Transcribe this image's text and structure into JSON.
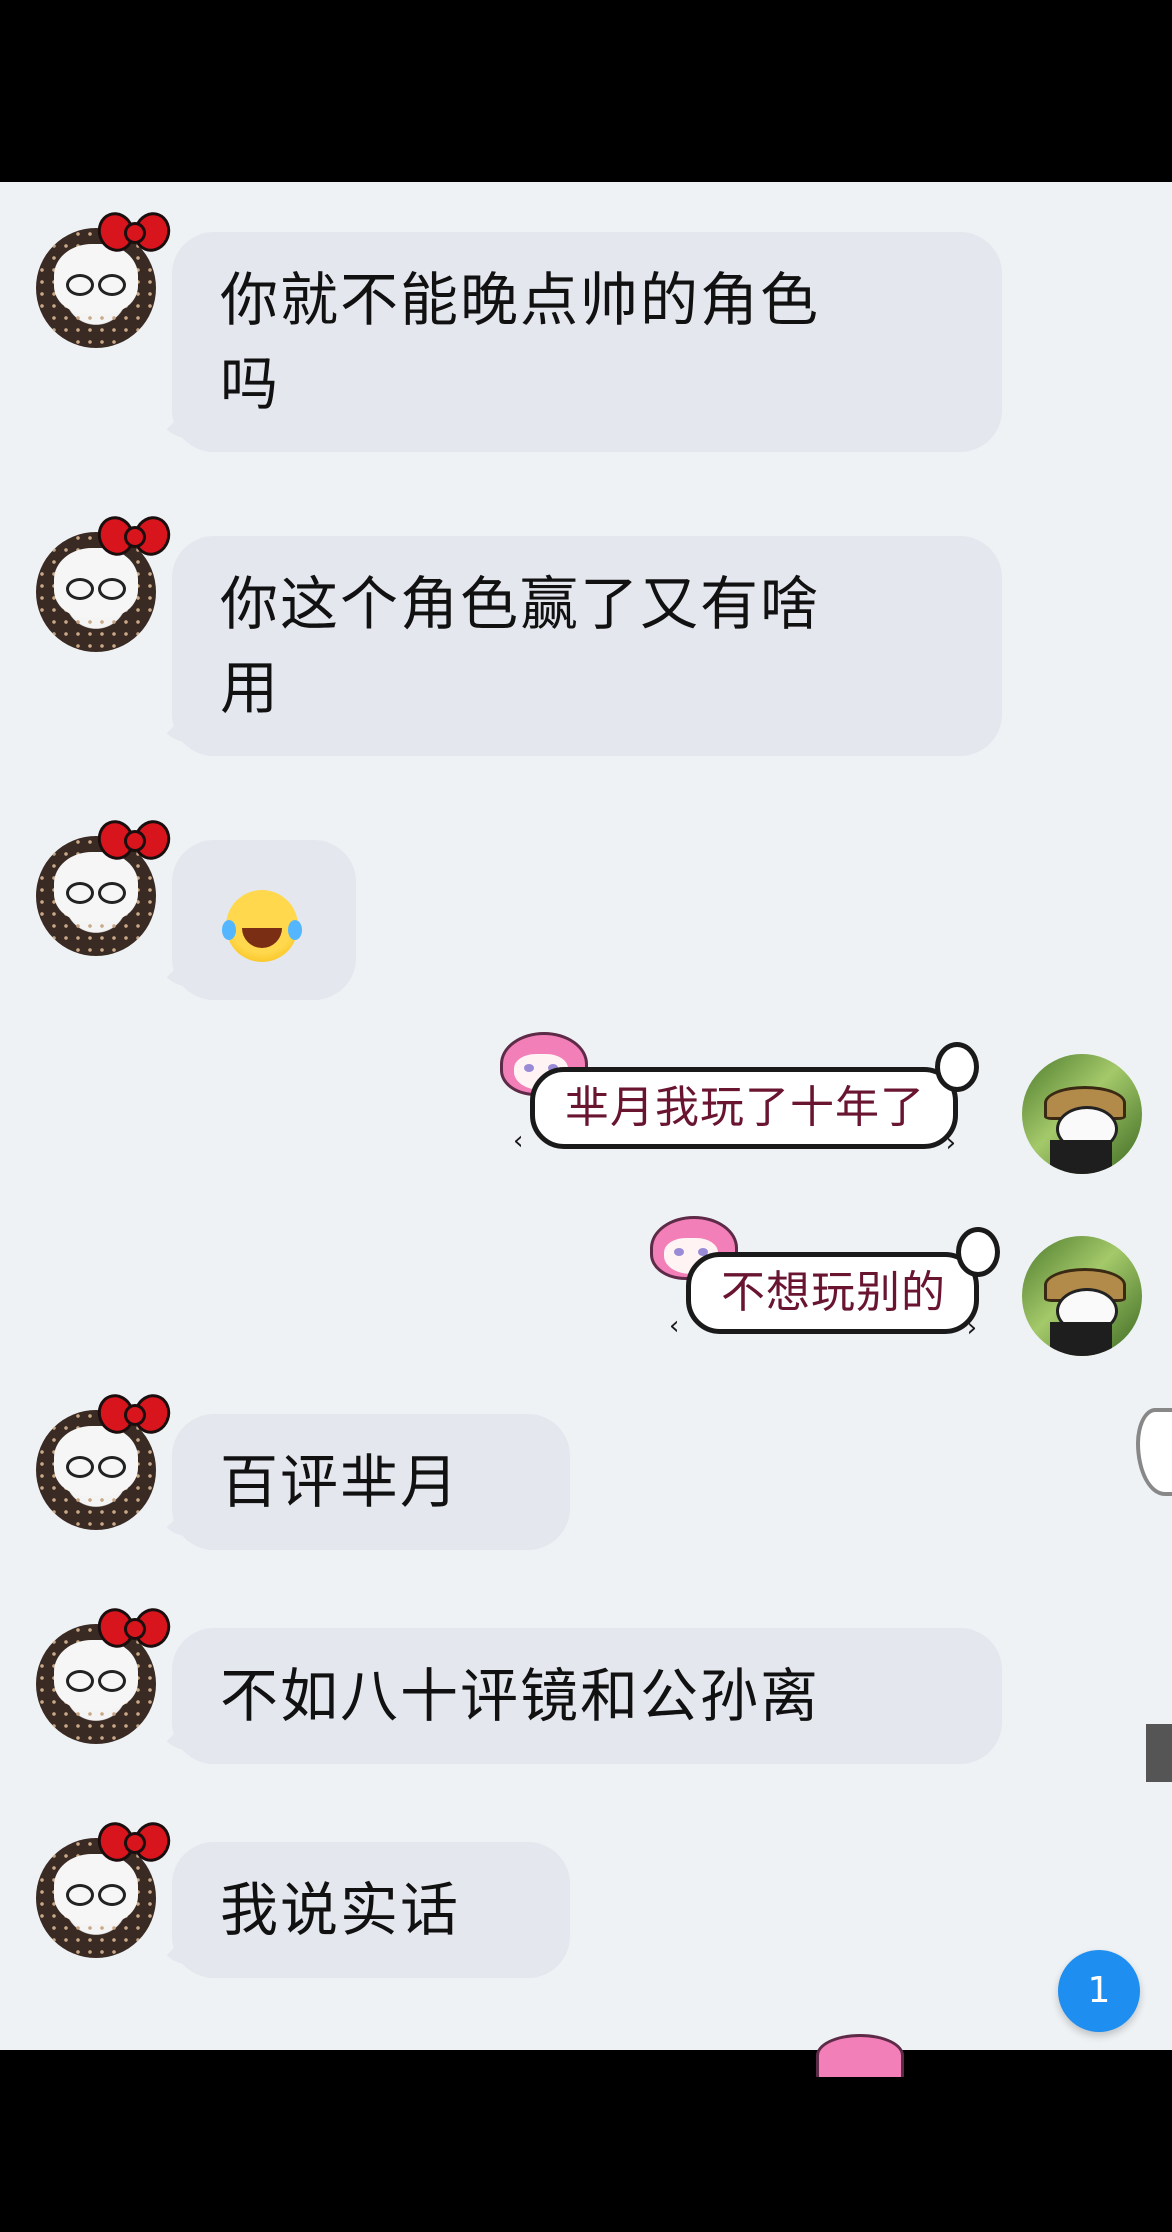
{
  "chat": {
    "messages": [
      {
        "side": "left",
        "type": "text",
        "text": "你就不能晚点帅的角色吗"
      },
      {
        "side": "left",
        "type": "text",
        "text": "你这个角色赢了又有啥用"
      },
      {
        "side": "left",
        "type": "emoji",
        "emoji": "laughing-with-tears"
      },
      {
        "side": "right",
        "type": "text",
        "text": "芈月我玩了十年了"
      },
      {
        "side": "right",
        "type": "text",
        "text": "不想玩别的"
      },
      {
        "side": "left",
        "type": "text",
        "text": "百评芈月"
      },
      {
        "side": "left",
        "type": "text",
        "text": "不如八十评镜和公孙离"
      },
      {
        "side": "left",
        "type": "text",
        "text": "我说实话"
      }
    ],
    "msg1_line1": "你就不能晚点帅的角色",
    "msg1_line2": "吗",
    "msg2_line1": "你这个角色赢了又有啥",
    "msg2_line2": "用",
    "msg4": "芈月我玩了十年了",
    "msg5": "不想玩别的",
    "msg6": "百评芈月",
    "msg7": "不如八十评镜和公孙离",
    "msg8": "我说实话"
  },
  "unread_count": "1",
  "colors": {
    "chat_background": "#eef2f5",
    "left_bubble": "#e4e7ee",
    "right_bubble_text": "#6a1530",
    "badge": "#1e8ef0"
  }
}
